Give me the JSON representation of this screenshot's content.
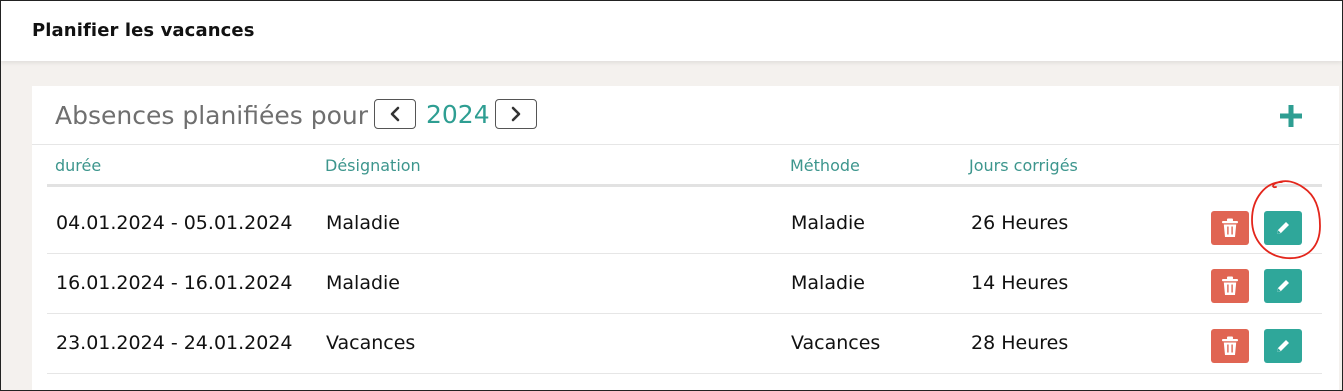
{
  "header": {
    "title": "Planifier les vacances"
  },
  "panel": {
    "title": "Absences planifiées pour",
    "year": "2024",
    "prev_icon": "chevron-left-icon",
    "next_icon": "chevron-right-icon",
    "add_icon": "plus-icon"
  },
  "table": {
    "columns": [
      "durée",
      "Désignation",
      "Méthode",
      "Jours corrigés"
    ],
    "rows": [
      {
        "duree": "04.01.2024 - 05.01.2024",
        "designation": "Maladie",
        "methode": "Maladie",
        "jours": "26 Heures"
      },
      {
        "duree": "16.01.2024 - 16.01.2024",
        "designation": "Maladie",
        "methode": "Maladie",
        "jours": "14 Heures"
      },
      {
        "duree": "23.01.2024 - 24.01.2024",
        "designation": "Vacances",
        "methode": "Vacances",
        "jours": "28 Heures"
      }
    ],
    "delete_icon": "trash-icon",
    "edit_icon": "pencil-icon"
  },
  "colors": {
    "accent": "#2e9e92",
    "delete": "#e06553",
    "edit": "#2fa79a",
    "annotation": "#e3261c"
  }
}
